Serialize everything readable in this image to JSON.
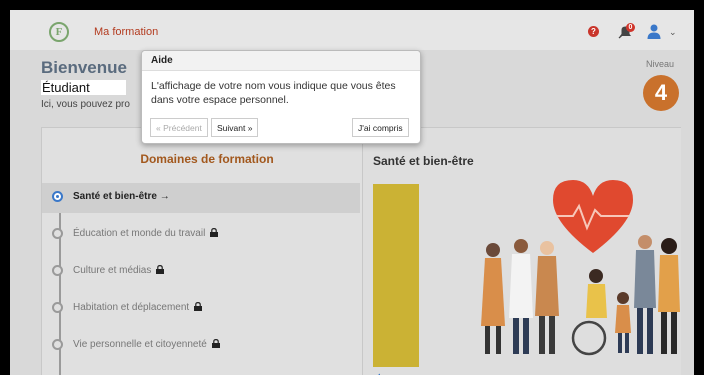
{
  "header": {
    "logo_letter": "F",
    "app_title": "Ma formation",
    "help_icon": "help-icon",
    "notification_count": "0",
    "icons": [
      "help-icon",
      "bell-icon",
      "user-icon",
      "chevron-down-icon"
    ]
  },
  "page": {
    "welcome": "Bienvenue",
    "student_name": "Étudiant",
    "intro": "Ici, vous pouvez pro",
    "level_label": "Niveau",
    "level_value": "4"
  },
  "domains": {
    "title": "Domaines de formation",
    "items": [
      {
        "label": "Santé et bien-être →",
        "active": true,
        "locked": false
      },
      {
        "label": "Éducation et monde du travail",
        "active": false,
        "locked": true
      },
      {
        "label": "Culture et médias",
        "active": false,
        "locked": true
      },
      {
        "label": "Habitation et déplacement",
        "active": false,
        "locked": true
      },
      {
        "label": "Vie personnelle et citoyenneté",
        "active": false,
        "locked": true
      }
    ]
  },
  "detail": {
    "title": "Santé et bien-être",
    "speaker_icon": "speaker-icon"
  },
  "popover": {
    "title": "Aide",
    "body": "L'affichage de votre nom vous indique que vous êtes dans votre espace personnel.",
    "prev_label": "« Précédent",
    "next_label": "Suivant »",
    "done_label": "J'ai compris"
  },
  "colors": {
    "accent_orange": "#c9712c",
    "title_brown": "#a2581d",
    "link_red": "#b33b1f",
    "active_blue": "#3a78c9",
    "yellow_bar": "#cbb234"
  }
}
